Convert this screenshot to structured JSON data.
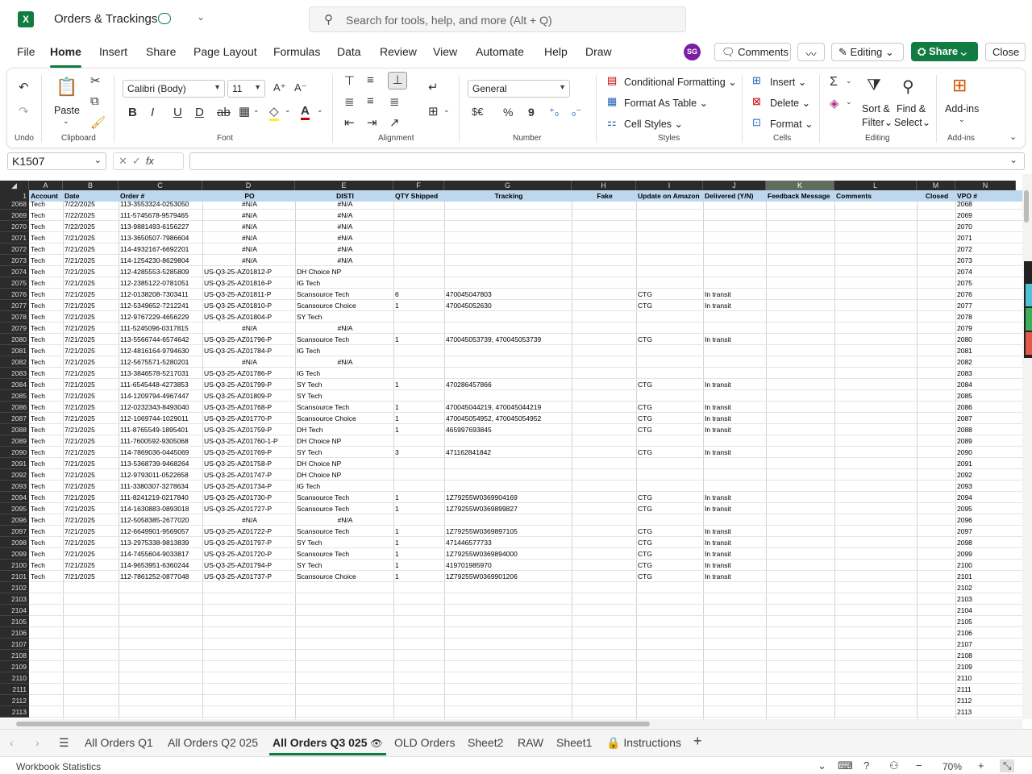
{
  "app": {
    "logo_letter": "X",
    "doc_title": "Orders & Trackings",
    "search_placeholder": "Search for tools, help, and more (Alt + Q)"
  },
  "menu": [
    "File",
    "Home",
    "Insert",
    "Share",
    "Page Layout",
    "Formulas",
    "Data",
    "Review",
    "View",
    "Automate",
    "Help",
    "Draw"
  ],
  "menu_active": "Home",
  "topbar": {
    "avatar": "SG",
    "comments": "Comments",
    "editing": "Editing",
    "share": "Share",
    "close": "Close"
  },
  "ribbon": {
    "undo_label": "Undo",
    "clipboard_label": "Clipboard",
    "paste": "Paste",
    "font_label": "Font",
    "font_name": "Calibri (Body)",
    "font_size": "11",
    "alignment_label": "Alignment",
    "number_label": "Number",
    "number_format": "General",
    "styles_label": "Styles",
    "conditional_formatting": "Conditional Formatting",
    "format_as_table": "Format As Table",
    "cell_styles": "Cell Styles",
    "cells_label": "Cells",
    "insert": "Insert",
    "delete": "Delete",
    "format": "Format",
    "editing_label": "Editing",
    "sort_filter_1": "Sort &",
    "sort_filter_2": "Filter",
    "find_select_1": "Find &",
    "find_select_2": "Select",
    "addins": "Add-ins",
    "addins_label": "Add-ins",
    "currency": "$€",
    "percent": "%",
    "comma": "9"
  },
  "formula": {
    "cell_ref": "K1507",
    "fx": "fx",
    "value": ""
  },
  "grid": {
    "columns": [
      "A",
      "B",
      "C",
      "D",
      "E",
      "F",
      "G",
      "H",
      "I",
      "J",
      "K",
      "L",
      "M",
      "N"
    ],
    "selected_column": "K",
    "headers": [
      "Account",
      "Date",
      "Order #",
      "PO",
      "DISTI",
      "QTY Shipped",
      "Tracking",
      "Fake",
      "Update on Amazon",
      "Delivered (Y/N)",
      "Feedback Message",
      "Comments",
      "Closed",
      "VPO #"
    ],
    "header_row_num": "1",
    "rows": [
      {
        "n": "2068",
        "a": "Tech",
        "b": "7/22/2025",
        "c": "113-3553324-0253050",
        "d": "#N/A",
        "e": "#N/A",
        "f": "",
        "g": "",
        "i": "",
        "j": ""
      },
      {
        "n": "2069",
        "a": "Tech",
        "b": "7/22/2025",
        "c": "111-5745678-9579465",
        "d": "#N/A",
        "e": "#N/A",
        "f": "",
        "g": "",
        "i": "",
        "j": ""
      },
      {
        "n": "2070",
        "a": "Tech",
        "b": "7/22/2025",
        "c": "113-9881493-6156227",
        "d": "#N/A",
        "e": "#N/A",
        "f": "",
        "g": "",
        "i": "",
        "j": ""
      },
      {
        "n": "2071",
        "a": "Tech",
        "b": "7/21/2025",
        "c": "113-3650507-7986604",
        "d": "#N/A",
        "e": "#N/A",
        "f": "",
        "g": "",
        "i": "",
        "j": ""
      },
      {
        "n": "2072",
        "a": "Tech",
        "b": "7/21/2025",
        "c": "114-4932167-6692201",
        "d": "#N/A",
        "e": "#N/A",
        "f": "",
        "g": "",
        "i": "",
        "j": ""
      },
      {
        "n": "2073",
        "a": "Tech",
        "b": "7/21/2025",
        "c": "114-1254230-8629804",
        "d": "#N/A",
        "e": "#N/A",
        "f": "",
        "g": "",
        "i": "",
        "j": ""
      },
      {
        "n": "2074",
        "a": "Tech",
        "b": "7/21/2025",
        "c": "112-4285553-5285809",
        "d": "US-Q3-25-AZ01812-P",
        "e": "DH Choice NP",
        "f": "",
        "g": "",
        "i": "",
        "j": ""
      },
      {
        "n": "2075",
        "a": "Tech",
        "b": "7/21/2025",
        "c": "112-2385122-0781051",
        "d": "US-Q3-25-AZ01816-P",
        "e": "IG Tech",
        "f": "",
        "g": "",
        "i": "",
        "j": ""
      },
      {
        "n": "2076",
        "a": "Tech",
        "b": "7/21/2025",
        "c": "112-0138208-7303411",
        "d": "US-Q3-25-AZ01811-P",
        "e": "Scansource Tech",
        "f": "6",
        "g": "470045047803",
        "i": "CTG",
        "j": "In transit"
      },
      {
        "n": "2077",
        "a": "Tech",
        "b": "7/21/2025",
        "c": "112-5349652-7212241",
        "d": "US-Q3-25-AZ01810-P",
        "e": "Scansource Choice",
        "f": "1",
        "g": "470045052630",
        "i": "CTG",
        "j": "In transit"
      },
      {
        "n": "2078",
        "a": "Tech",
        "b": "7/21/2025",
        "c": "112-9767229-4656229",
        "d": "US-Q3-25-AZ01804-P",
        "e": "SY Tech",
        "f": "",
        "g": "",
        "i": "",
        "j": ""
      },
      {
        "n": "2079",
        "a": "Tech",
        "b": "7/21/2025",
        "c": "111-5245096-0317815",
        "d": "#N/A",
        "e": "#N/A",
        "f": "",
        "g": "",
        "i": "",
        "j": ""
      },
      {
        "n": "2080",
        "a": "Tech",
        "b": "7/21/2025",
        "c": "113-5566744-6574642",
        "d": "US-Q3-25-AZ01796-P",
        "e": "Scansource Tech",
        "f": "1",
        "g": "470045053739, 470045053739",
        "i": "CTG",
        "j": "In transit"
      },
      {
        "n": "2081",
        "a": "Tech",
        "b": "7/21/2025",
        "c": "112-4816164-9794630",
        "d": "US-Q3-25-AZ01784-P",
        "e": "IG Tech",
        "f": "",
        "g": "",
        "i": "",
        "j": ""
      },
      {
        "n": "2082",
        "a": "Tech",
        "b": "7/21/2025",
        "c": "112-5675571-5280201",
        "d": "#N/A",
        "e": "#N/A",
        "f": "",
        "g": "",
        "i": "",
        "j": ""
      },
      {
        "n": "2083",
        "a": "Tech",
        "b": "7/21/2025",
        "c": "113-3846578-5217031",
        "d": "US-Q3-25-AZ01786-P",
        "e": "IG Tech",
        "f": "",
        "g": "",
        "i": "",
        "j": ""
      },
      {
        "n": "2084",
        "a": "Tech",
        "b": "7/21/2025",
        "c": "111-6545448-4273853",
        "d": "US-Q3-25-AZ01799-P",
        "e": "SY Tech",
        "f": "1",
        "g": "470286457866",
        "i": "CTG",
        "j": "In transit"
      },
      {
        "n": "2085",
        "a": "Tech",
        "b": "7/21/2025",
        "c": "114-1209794-4967447",
        "d": "US-Q3-25-AZ01809-P",
        "e": "SY Tech",
        "f": "",
        "g": "",
        "i": "",
        "j": ""
      },
      {
        "n": "2086",
        "a": "Tech",
        "b": "7/21/2025",
        "c": "112-0232343-8493040",
        "d": "US-Q3-25-AZ01768-P",
        "e": "Scansource Tech",
        "f": "1",
        "g": "470045044219, 470045044219",
        "i": "CTG",
        "j": "In transit"
      },
      {
        "n": "2087",
        "a": "Tech",
        "b": "7/21/2025",
        "c": "112-1069744-1029011",
        "d": "US-Q3-25-AZ01770-P",
        "e": "Scansource Choice",
        "f": "1",
        "g": "470045054952, 470045054952",
        "i": "CTG",
        "j": "In transit"
      },
      {
        "n": "2088",
        "a": "Tech",
        "b": "7/21/2025",
        "c": "111-8765549-1895401",
        "d": "US-Q3-25-AZ01759-P",
        "e": "DH Tech",
        "f": "1",
        "g": "465997693845",
        "i": "CTG",
        "j": "In transit"
      },
      {
        "n": "2089",
        "a": "Tech",
        "b": "7/21/2025",
        "c": "111-7600592-9305068",
        "d": "US-Q3-25-AZ01760-1-P",
        "e": "DH Choice NP",
        "f": "",
        "g": "",
        "i": "",
        "j": ""
      },
      {
        "n": "2090",
        "a": "Tech",
        "b": "7/21/2025",
        "c": "114-7869036-0445069",
        "d": "US-Q3-25-AZ01769-P",
        "e": "SY Tech",
        "f": "3",
        "g": "471162841842",
        "i": "CTG",
        "j": "In transit"
      },
      {
        "n": "2091",
        "a": "Tech",
        "b": "7/21/2025",
        "c": "113-5368739-9468264",
        "d": "US-Q3-25-AZ01758-P",
        "e": "DH Choice NP",
        "f": "",
        "g": "",
        "i": "",
        "j": ""
      },
      {
        "n": "2092",
        "a": "Tech",
        "b": "7/21/2025",
        "c": "112-9793011-0522658",
        "d": "US-Q3-25-AZ01747-P",
        "e": "DH Choice NP",
        "f": "",
        "g": "",
        "i": "",
        "j": ""
      },
      {
        "n": "2093",
        "a": "Tech",
        "b": "7/21/2025",
        "c": "111-3380307-3278634",
        "d": "US-Q3-25-AZ01734-P",
        "e": "IG Tech",
        "f": "",
        "g": "",
        "i": "",
        "j": ""
      },
      {
        "n": "2094",
        "a": "Tech",
        "b": "7/21/2025",
        "c": "111-8241219-0217840",
        "d": "US-Q3-25-AZ01730-P",
        "e": "Scansource Tech",
        "f": "1",
        "g": "1Z79255W0369904169",
        "i": "CTG",
        "j": "In transit"
      },
      {
        "n": "2095",
        "a": "Tech",
        "b": "7/21/2025",
        "c": "114-1630883-0893018",
        "d": "US-Q3-25-AZ01727-P",
        "e": "Scansource Tech",
        "f": "1",
        "g": "1Z79255W0369899827",
        "i": "CTG",
        "j": "In transit"
      },
      {
        "n": "2096",
        "a": "Tech",
        "b": "7/21/2025",
        "c": "112-5058385-2677020",
        "d": "#N/A",
        "e": "#N/A",
        "f": "",
        "g": "",
        "i": "",
        "j": ""
      },
      {
        "n": "2097",
        "a": "Tech",
        "b": "7/21/2025",
        "c": "112-6649901-9569057",
        "d": "US-Q3-25-AZ01722-P",
        "e": "Scansource Tech",
        "f": "1",
        "g": "1Z79255W0369897105",
        "i": "CTG",
        "j": "In transit"
      },
      {
        "n": "2098",
        "a": "Tech",
        "b": "7/21/2025",
        "c": "113-2975338-9813839",
        "d": "US-Q3-25-AZ01797-P",
        "e": "SY Tech",
        "f": "1",
        "g": "471446577733",
        "i": "CTG",
        "j": "In transit"
      },
      {
        "n": "2099",
        "a": "Tech",
        "b": "7/21/2025",
        "c": "114-7455604-9033817",
        "d": "US-Q3-25-AZ01720-P",
        "e": "Scansource Tech",
        "f": "1",
        "g": "1Z79255W0369894000",
        "i": "CTG",
        "j": "In transit"
      },
      {
        "n": "2100",
        "a": "Tech",
        "b": "7/21/2025",
        "c": "114-9653951-6360244",
        "d": "US-Q3-25-AZ01794-P",
        "e": "SY Tech",
        "f": "1",
        "g": "419701985970",
        "i": "CTG",
        "j": "In transit"
      },
      {
        "n": "2101",
        "a": "Tech",
        "b": "7/21/2025",
        "c": "112-7861252-0877048",
        "d": "US-Q3-25-AZ01737-P",
        "e": "Scansource Choice",
        "f": "1",
        "g": "1Z79255W0369901206",
        "i": "CTG",
        "j": "In transit"
      },
      {
        "n": "2102"
      },
      {
        "n": "2103"
      },
      {
        "n": "2104"
      },
      {
        "n": "2105"
      },
      {
        "n": "2106"
      },
      {
        "n": "2107"
      },
      {
        "n": "2108"
      },
      {
        "n": "2109"
      },
      {
        "n": "2110"
      },
      {
        "n": "2111"
      },
      {
        "n": "2112"
      },
      {
        "n": "2113"
      }
    ]
  },
  "sheets": [
    "All Orders Q1",
    "All Orders Q2 025",
    "All Orders Q3 025",
    "OLD Orders",
    "Sheet2",
    "RAW",
    "Sheet1",
    "Instructions"
  ],
  "active_sheet": "All Orders Q3 025",
  "status": {
    "left": "Workbook Statistics",
    "zoom": "70%"
  },
  "colors": {
    "accent": "#107c41",
    "header_fill": "#bdd7ee",
    "dark_header": "#2b2b2b"
  }
}
